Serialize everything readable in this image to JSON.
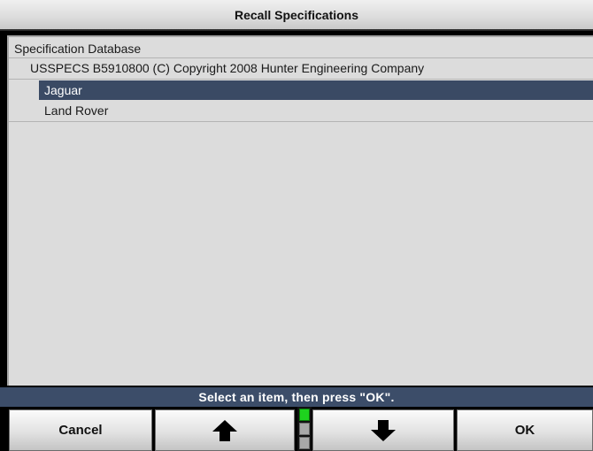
{
  "window": {
    "title": "Recall Specifications"
  },
  "tree": {
    "root_label": "Specification Database",
    "database_label": "USSPECS B5910800 (C) Copyright 2008 Hunter Engineering Company",
    "items": [
      {
        "label": "Jaguar",
        "selected": true
      },
      {
        "label": "Land Rover",
        "selected": false
      }
    ]
  },
  "status": {
    "message": "Select an item, then press \"OK\"."
  },
  "softkeys": {
    "cancel_label": "Cancel",
    "up_icon": "arrow-up-icon",
    "down_icon": "arrow-down-icon",
    "ok_label": "OK"
  },
  "scroll_indicator": {
    "segments": 3,
    "active_segment": 1
  },
  "colors": {
    "selection": "#3a4a64",
    "status_bar": "#3c4d69",
    "panel": "#dcdcdc",
    "indicator_active": "#1ed21e"
  }
}
